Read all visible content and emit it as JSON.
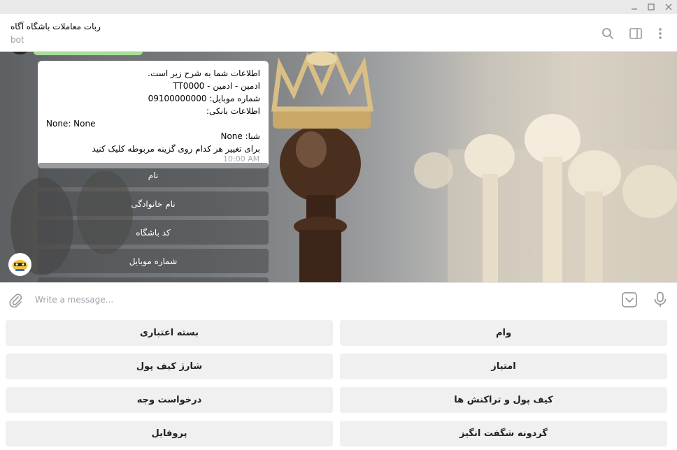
{
  "window": {
    "minimize_icon": "minimize-icon",
    "maximize_icon": "maximize-icon",
    "close_icon": "close-icon"
  },
  "header": {
    "title": "ربات معاملات باشگاه آگاه",
    "subtitle": "bot",
    "icons": [
      "search-icon",
      "sidebar-icon",
      "more-vertical-icon"
    ]
  },
  "message": {
    "lines": [
      "اطلاعات شما به شرح زیر است.",
      "ادمین - ادمین - TT0000",
      "شماره موبایل: 09100000000",
      "اطلاعات بانکی:",
      "None: None",
      "شبا: None",
      "برای تغییر هر کدام روی گزینه مربوطه کلیک کنید"
    ],
    "time": "10:00 AM"
  },
  "inline_buttons": [
    "نام",
    "نام خانوادگی",
    "کد باشگاه",
    "شماره موبایل"
  ],
  "composer": {
    "placeholder": "Write a message...",
    "icons": [
      "attach-icon",
      "bot-keyboard-icon",
      "microphone-icon"
    ]
  },
  "keyboard": {
    "rows": [
      [
        "وام",
        "بسته اعتباری"
      ],
      [
        "امتیاز",
        "شارژ کیف پول"
      ],
      [
        "کیف پول و تراکنش ها",
        "درخواست وجه"
      ],
      [
        "گردونه شگفت انگیز",
        "پروفایل"
      ]
    ]
  },
  "colors": {
    "accent_green": "#a8dd9b",
    "icon_gray": "#999999",
    "time_color": "#a0acb6"
  }
}
